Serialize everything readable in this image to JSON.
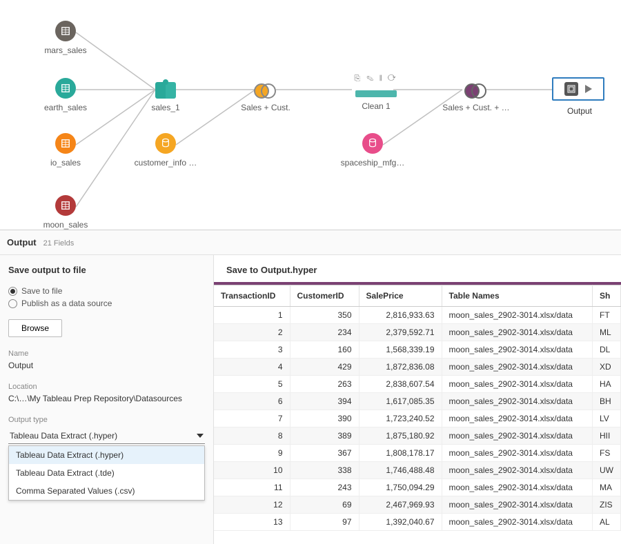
{
  "flow": {
    "nodes": {
      "mars_sales": {
        "label": "mars_sales"
      },
      "earth_sales": {
        "label": "earth_sales"
      },
      "io_sales": {
        "label": "io_sales"
      },
      "moon_sales": {
        "label": "moon_sales"
      },
      "sales_1": {
        "label": "sales_1"
      },
      "customer_info": {
        "label": "customer_info …"
      },
      "sales_cust": {
        "label": "Sales + Cust."
      },
      "clean1": {
        "label": "Clean 1"
      },
      "spaceship_mfg": {
        "label": "spaceship_mfg…"
      },
      "sales_cust_plus": {
        "label": "Sales + Cust. + …"
      },
      "output": {
        "label": "Output"
      }
    }
  },
  "panel": {
    "title": "Output",
    "fields_count": "21 Fields"
  },
  "left": {
    "heading": "Save output to file",
    "radio_save_to_file": "Save to file",
    "radio_publish": "Publish as a data source",
    "browse": "Browse",
    "name_label": "Name",
    "name_value": "Output",
    "location_label": "Location",
    "location_value": "C:\\…\\My Tableau Prep Repository\\Datasources",
    "output_type_label": "Output type",
    "output_type_selected": "Tableau Data Extract (.hyper)",
    "dropdown": [
      "Tableau Data Extract (.hyper)",
      "Tableau Data Extract (.tde)",
      "Comma Separated Values (.csv)"
    ]
  },
  "right": {
    "title": "Save to Output.hyper",
    "columns": [
      "TransactionID",
      "CustomerID",
      "SalePrice",
      "Table Names",
      "Sh"
    ],
    "rows": [
      {
        "tid": "1",
        "cid": "350",
        "price": "2,816,933.63",
        "tbl": "moon_sales_2902-3014.xlsx/data",
        "s": "FT"
      },
      {
        "tid": "2",
        "cid": "234",
        "price": "2,379,592.71",
        "tbl": "moon_sales_2902-3014.xlsx/data",
        "s": "ML"
      },
      {
        "tid": "3",
        "cid": "160",
        "price": "1,568,339.19",
        "tbl": "moon_sales_2902-3014.xlsx/data",
        "s": "DL"
      },
      {
        "tid": "4",
        "cid": "429",
        "price": "1,872,836.08",
        "tbl": "moon_sales_2902-3014.xlsx/data",
        "s": "XD"
      },
      {
        "tid": "5",
        "cid": "263",
        "price": "2,838,607.54",
        "tbl": "moon_sales_2902-3014.xlsx/data",
        "s": "HA"
      },
      {
        "tid": "6",
        "cid": "394",
        "price": "1,617,085.35",
        "tbl": "moon_sales_2902-3014.xlsx/data",
        "s": "BH"
      },
      {
        "tid": "7",
        "cid": "390",
        "price": "1,723,240.52",
        "tbl": "moon_sales_2902-3014.xlsx/data",
        "s": "LV"
      },
      {
        "tid": "8",
        "cid": "389",
        "price": "1,875,180.92",
        "tbl": "moon_sales_2902-3014.xlsx/data",
        "s": "HII"
      },
      {
        "tid": "9",
        "cid": "367",
        "price": "1,808,178.17",
        "tbl": "moon_sales_2902-3014.xlsx/data",
        "s": "FS"
      },
      {
        "tid": "10",
        "cid": "338",
        "price": "1,746,488.48",
        "tbl": "moon_sales_2902-3014.xlsx/data",
        "s": "UW"
      },
      {
        "tid": "11",
        "cid": "243",
        "price": "1,750,094.29",
        "tbl": "moon_sales_2902-3014.xlsx/data",
        "s": "MA"
      },
      {
        "tid": "12",
        "cid": "69",
        "price": "2,467,969.93",
        "tbl": "moon_sales_2902-3014.xlsx/data",
        "s": "ZIS"
      },
      {
        "tid": "13",
        "cid": "97",
        "price": "1,392,040.67",
        "tbl": "moon_sales_2902-3014.xlsx/data",
        "s": "AL"
      }
    ]
  }
}
